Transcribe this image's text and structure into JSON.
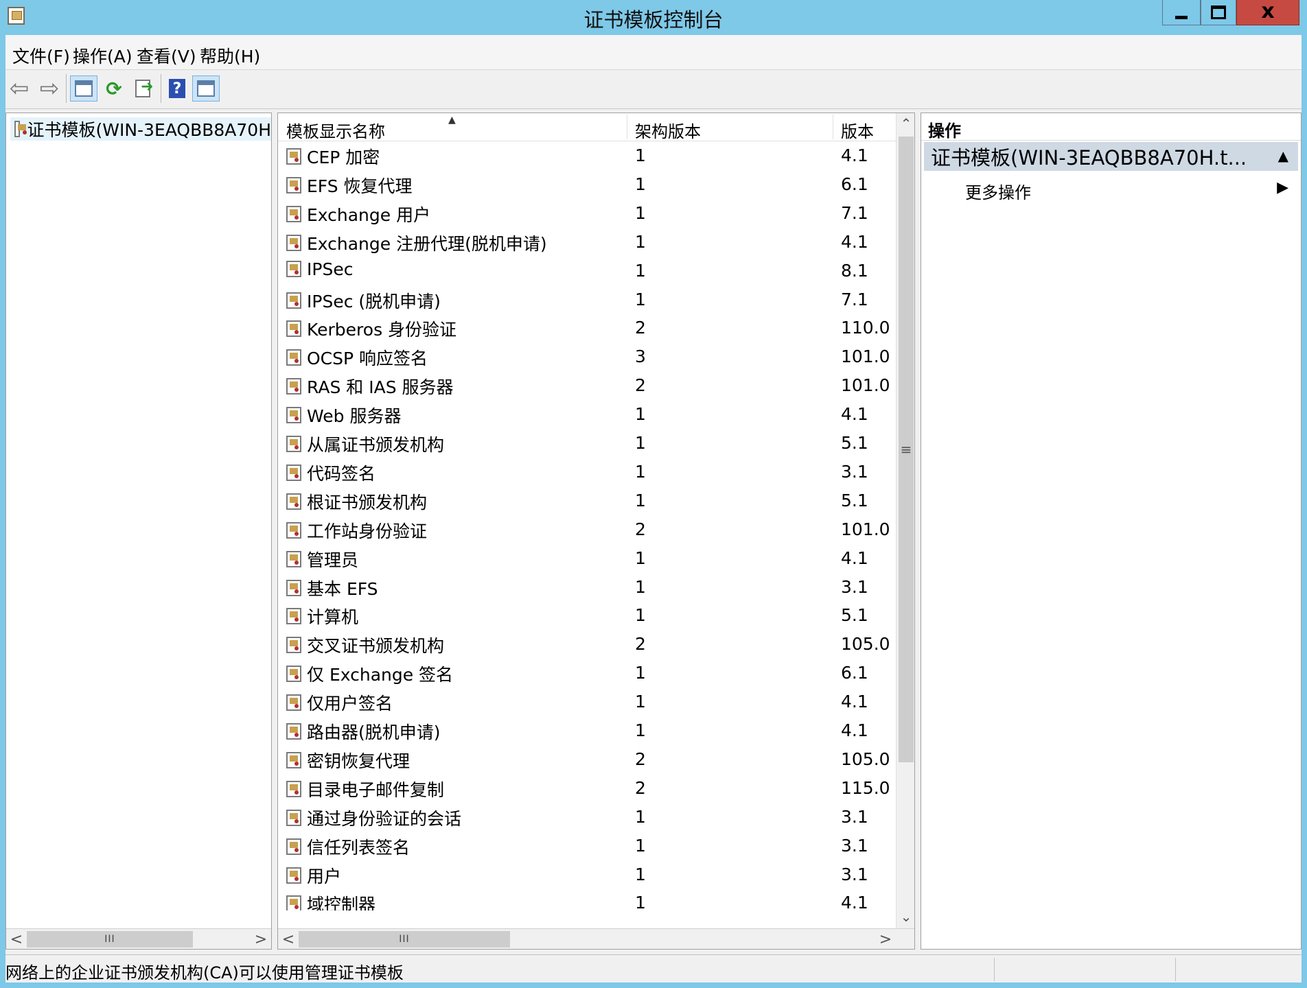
{
  "window": {
    "title": "证书模板控制台",
    "close_label": "x"
  },
  "menu": [
    {
      "label": "文件(F)"
    },
    {
      "label": "操作(A)"
    },
    {
      "label": "查看(V)"
    },
    {
      "label": "帮助(H)"
    }
  ],
  "toolbar": {
    "icons": [
      "back-arrow-icon",
      "forward-arrow-icon",
      "show-hide-console-tree-icon",
      "refresh-icon",
      "export-list-icon",
      "help-icon",
      "show-hide-action-pane-icon"
    ]
  },
  "tree": {
    "root_label": "证书模板(WIN-3EAQBB8A70H"
  },
  "list": {
    "columns": [
      "模板显示名称",
      "架构版本",
      "版本"
    ],
    "sorted_column": "模板显示名称",
    "rows": [
      {
        "name": "CEP 加密",
        "schema": "1",
        "version": "4.1"
      },
      {
        "name": "EFS 恢复代理",
        "schema": "1",
        "version": "6.1"
      },
      {
        "name": "Exchange 用户",
        "schema": "1",
        "version": "7.1"
      },
      {
        "name": "Exchange 注册代理(脱机申请)",
        "schema": "1",
        "version": "4.1"
      },
      {
        "name": "IPSec",
        "schema": "1",
        "version": "8.1"
      },
      {
        "name": "IPSec (脱机申请)",
        "schema": "1",
        "version": "7.1"
      },
      {
        "name": "Kerberos 身份验证",
        "schema": "2",
        "version": "110.0"
      },
      {
        "name": "OCSP 响应签名",
        "schema": "3",
        "version": "101.0"
      },
      {
        "name": "RAS 和 IAS 服务器",
        "schema": "2",
        "version": "101.0"
      },
      {
        "name": "Web 服务器",
        "schema": "1",
        "version": "4.1"
      },
      {
        "name": "从属证书颁发机构",
        "schema": "1",
        "version": "5.1"
      },
      {
        "name": "代码签名",
        "schema": "1",
        "version": "3.1"
      },
      {
        "name": "根证书颁发机构",
        "schema": "1",
        "version": "5.1"
      },
      {
        "name": "工作站身份验证",
        "schema": "2",
        "version": "101.0"
      },
      {
        "name": "管理员",
        "schema": "1",
        "version": "4.1"
      },
      {
        "name": "基本 EFS",
        "schema": "1",
        "version": "3.1"
      },
      {
        "name": "计算机",
        "schema": "1",
        "version": "5.1"
      },
      {
        "name": "交叉证书颁发机构",
        "schema": "2",
        "version": "105.0"
      },
      {
        "name": "仅 Exchange 签名",
        "schema": "1",
        "version": "6.1"
      },
      {
        "name": "仅用户签名",
        "schema": "1",
        "version": "4.1"
      },
      {
        "name": "路由器(脱机申请)",
        "schema": "1",
        "version": "4.1"
      },
      {
        "name": "密钥恢复代理",
        "schema": "2",
        "version": "105.0"
      },
      {
        "name": "目录电子邮件复制",
        "schema": "2",
        "version": "115.0"
      },
      {
        "name": "通过身份验证的会话",
        "schema": "1",
        "version": "3.1"
      },
      {
        "name": "信任列表签名",
        "schema": "1",
        "version": "3.1"
      },
      {
        "name": "用户",
        "schema": "1",
        "version": "3.1"
      },
      {
        "name": "域控制器",
        "schema": "1",
        "version": "4.1"
      }
    ]
  },
  "actions": {
    "header": "操作",
    "section_title": "证书模板(WIN-3EAQBB8A70H.t...",
    "items": [
      {
        "label": "更多操作"
      }
    ]
  },
  "status": {
    "text": "网络上的企业证书颁发机构(CA)可以使用管理证书模板"
  },
  "scroll_grip": "III",
  "colors": {
    "titlebar": "#7ec8e8",
    "close_button": "#c74a42",
    "selection": "#e5f3fb",
    "action_section": "#cfd9e4"
  }
}
